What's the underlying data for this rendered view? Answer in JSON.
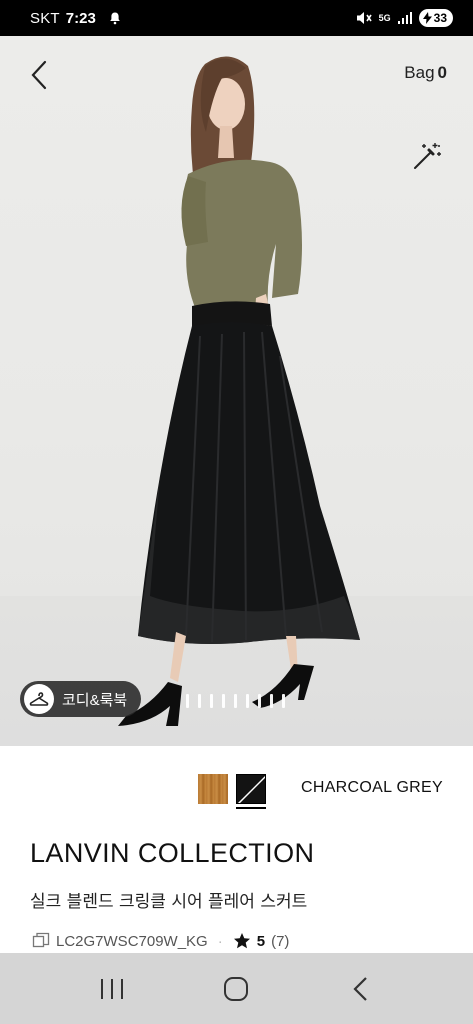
{
  "status_bar": {
    "carrier": "SKT",
    "time": "7:23",
    "network": "5G",
    "battery": "33",
    "icons": [
      "notification-bell-icon",
      "mute-icon",
      "signal-icon",
      "battery-icon"
    ]
  },
  "header": {
    "back_icon": "chevron-left-icon",
    "bag_label": "Bag",
    "bag_count": "0",
    "magic_icon": "magic-wand-icon"
  },
  "hero": {
    "coordi_label": "코디&룩북",
    "coordi_icon": "hanger-icon",
    "page_indicator_count": 9
  },
  "product": {
    "colors": [
      {
        "name": "wood-brown",
        "hex": "#b97a34"
      },
      {
        "name": "charcoal",
        "hex": "#131313",
        "selected": true
      }
    ],
    "selected_color_name": "CHARCOAL GREY",
    "brand": "LANVIN COLLECTION",
    "name": "실크 블렌드 크링클 시어 플레어 스커트",
    "code": "LC2G7WSC709W_KG",
    "separator": "·",
    "rating": "5",
    "review_count": "(7)"
  },
  "nav_bar": {
    "icons": [
      "recent-apps-icon",
      "home-icon",
      "back-icon"
    ]
  }
}
